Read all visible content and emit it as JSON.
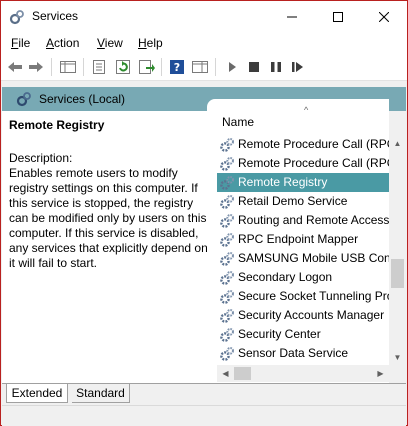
{
  "window": {
    "title": "Services",
    "accent_color": "#b9211f"
  },
  "menu": [
    {
      "key": "F",
      "rest": "ile"
    },
    {
      "key": "A",
      "rest": "ction"
    },
    {
      "key": "V",
      "rest": "iew"
    },
    {
      "key": "H",
      "rest": "elp"
    }
  ],
  "toolbar_icons": [
    "back-icon",
    "forward-icon",
    "show-hide-tree-icon",
    "properties-icon",
    "refresh-icon",
    "export-list-icon",
    "help-icon",
    "show-hide-action-pane-icon",
    "start-icon",
    "stop-icon",
    "pause-icon",
    "restart-icon"
  ],
  "pane_header": {
    "title": "Services (Local)",
    "color": "#78a9b4"
  },
  "details": {
    "service_name": "Remote Registry",
    "description_label": "Description:",
    "description": "Enables remote users to modify registry settings on this computer. If this service is stopped, the registry can be modified only by users on this computer. If this service is disabled, any services that explicitly depend on it will fail to start."
  },
  "list": {
    "column_name": "Name",
    "sort_indicator": "^",
    "selected_color": "#4a9aa4",
    "items": [
      "Remote Procedure Call (RPC)",
      "Remote Procedure Call (RPC) Locator",
      "Remote Registry",
      "Retail Demo Service",
      "Routing and Remote Access",
      "RPC Endpoint Mapper",
      "SAMSUNG Mobile USB Connectivity Service",
      "Secondary Logon",
      "Secure Socket Tunneling Protocol Service",
      "Security Accounts Manager",
      "Security Center",
      "Sensor Data Service"
    ],
    "selected_index": 2
  },
  "tabs": [
    "Extended",
    "Standard"
  ]
}
